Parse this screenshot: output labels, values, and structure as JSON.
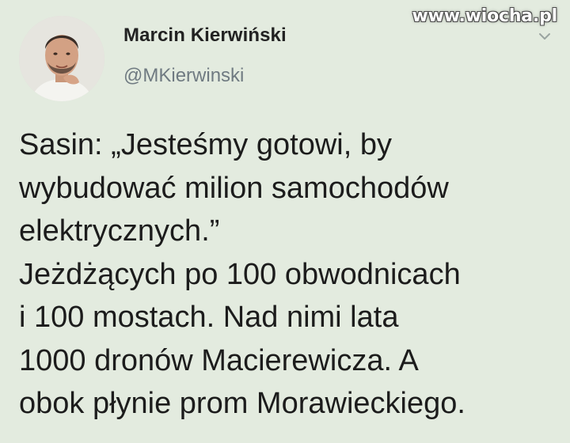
{
  "author": {
    "name": "Marcin Kierwiński",
    "handle": "@MKierwinski"
  },
  "tweet": {
    "lines": [
      "Sasin: „Jesteśmy gotowi, by",
      "wybudować milion samochodów",
      "elektrycznych.”",
      "Jeżdżących po 100 obwodnicach",
      "i 100 mostach. Nad nimi lata",
      "1000 dronów Macierewicza. A",
      "obok płynie prom Morawieckiego."
    ]
  },
  "watermark": {
    "text": "www.wiocha.pl"
  },
  "icons": {
    "avatar": "profile-photo",
    "menu": "chevron-down-icon"
  },
  "colors": {
    "background": "#e3ebdf",
    "handle": "#6f7a81",
    "name": "#222222"
  }
}
